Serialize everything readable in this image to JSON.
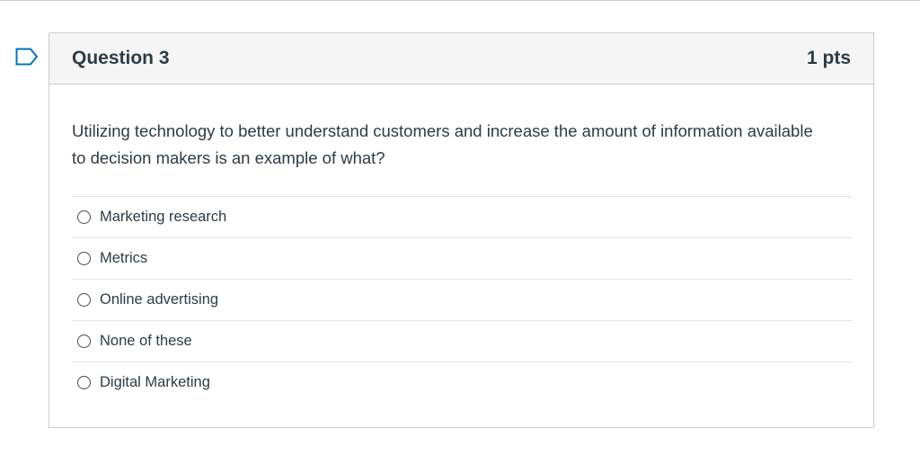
{
  "question": {
    "title": "Question 3",
    "points": "1 pts",
    "text": "Utilizing technology to better understand customers and increase the amount of information available to decision makers is an example of what?",
    "answers": [
      {
        "label": "Marketing research"
      },
      {
        "label": "Metrics"
      },
      {
        "label": "Online advertising"
      },
      {
        "label": "None of these"
      },
      {
        "label": "Digital Marketing"
      }
    ]
  },
  "icons": {
    "flag": "flag-icon",
    "radio": "radio-unchecked-icon"
  },
  "colors": {
    "flag_outline": "#0374b5",
    "text": "#2d3b45",
    "header_bg": "#f5f5f5",
    "border": "#c7cdd1"
  }
}
